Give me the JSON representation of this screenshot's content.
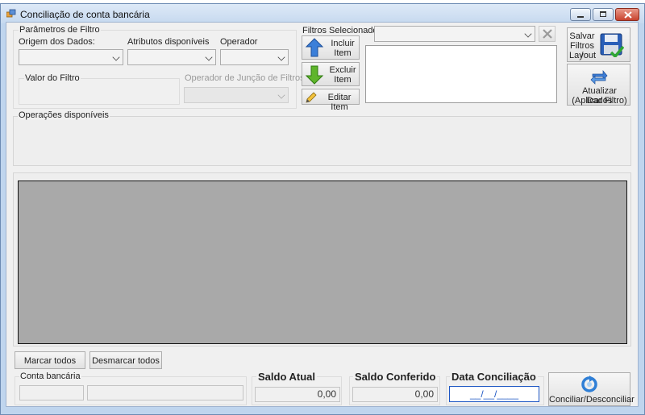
{
  "window": {
    "title": "Conciliação de conta bancária"
  },
  "filter_params": {
    "group_label": "Parâmetros de Filtro",
    "origin_label": "Origem dos Dados:",
    "attributes_label": "Atributos disponíveis",
    "operator_label": "Operador",
    "value_label": "Valor do Filtro",
    "join_operator_label": "Operador de Junção de Filtros"
  },
  "selected_filters": {
    "label": "Filtros Selecionados",
    "include_line1": "Incluir",
    "include_line2": "Item",
    "exclude_line1": "Excluir",
    "exclude_line2": "Item",
    "edit_label": "Editar Item"
  },
  "actions": {
    "save_line1": "Salvar",
    "save_line2": "Filtros /",
    "save_line3": "Layout",
    "refresh_line1": "Atualizar Dados",
    "refresh_line2": "(Aplicar Filtro)"
  },
  "operations": {
    "label": "Operações disponíveis"
  },
  "grid_actions": {
    "mark_all": "Marcar todos",
    "unmark_all": "Desmarcar todos"
  },
  "bank_account": {
    "label": "Conta bancária"
  },
  "balances": {
    "current_label": "Saldo Atual",
    "current_value": "0,00",
    "checked_label": "Saldo Conferido",
    "checked_value": "0,00"
  },
  "reconciliation": {
    "date_label": "Data Conciliação",
    "date_value": "__/__/____",
    "button_label": "Conciliar/Desconciliar"
  },
  "colors": {
    "accent_blue": "#1e57c4",
    "title_bar": "#c6d9ef",
    "grid_bg": "#a9a9a9"
  }
}
